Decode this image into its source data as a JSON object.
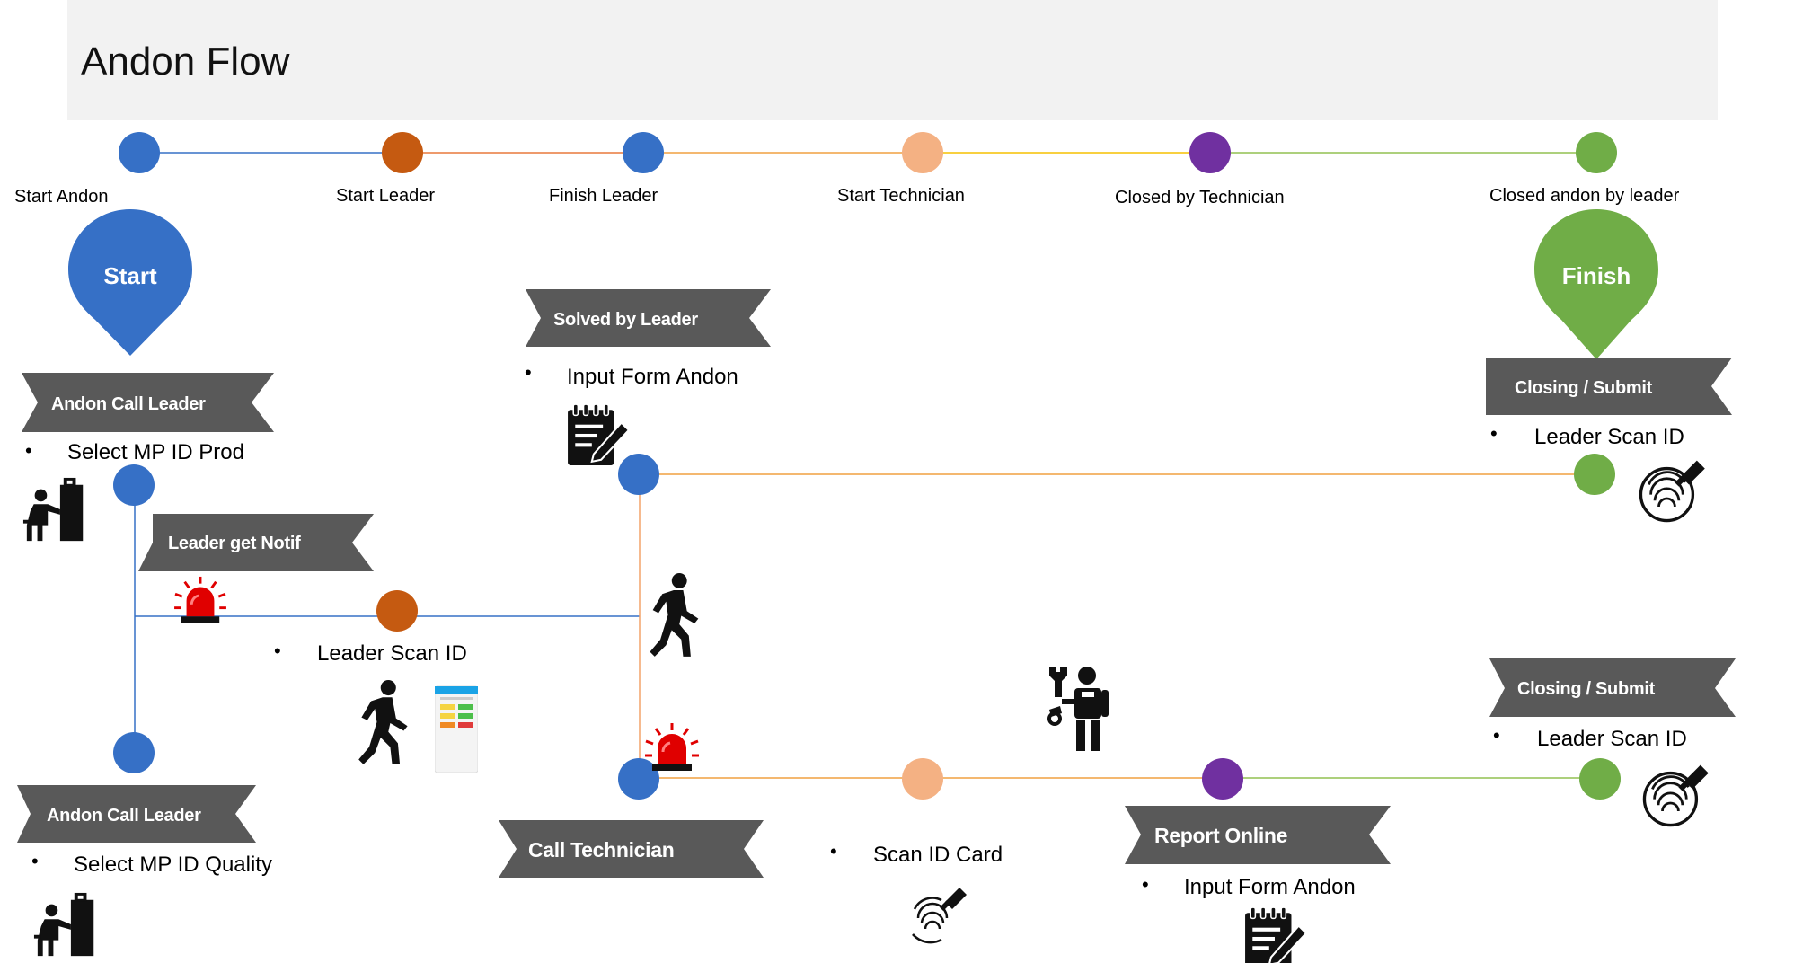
{
  "title": "Andon Flow",
  "colors": {
    "blue": "#3670c6",
    "orange": "#c55a11",
    "peach": "#f4b183",
    "purple": "#7030a0",
    "green": "#70ad47",
    "banner": "#595959",
    "header_bg": "#f2f2f2",
    "alarm": "#e00000"
  },
  "timeline": {
    "stages": [
      {
        "label": "Start Andon",
        "color": "#3670c6"
      },
      {
        "label": "Start Leader",
        "color": "#c55a11"
      },
      {
        "label": "Finish Leader",
        "color": "#3670c6"
      },
      {
        "label": "Start Technician",
        "color": "#f4b183"
      },
      {
        "label": "Closed by Technician",
        "color": "#7030a0"
      },
      {
        "label": "Closed andon by leader",
        "color": "#70ad47"
      }
    ]
  },
  "pins": {
    "start": "Start",
    "finish": "Finish"
  },
  "banners": {
    "andon_call_leader_prod": "Andon Call Leader",
    "leader_get_notif": "Leader get Notif",
    "solved_by_leader": "Solved by Leader",
    "closing_submit_top": "Closing / Submit",
    "closing_submit_bottom": "Closing / Submit",
    "andon_call_leader_quality": "Andon Call Leader",
    "call_technician": "Call Technician",
    "report_online": "Report Online"
  },
  "bullets": {
    "select_mp_prod": "Select MP ID Prod",
    "leader_scan_mid": "Leader Scan ID",
    "input_form_top": "Input Form Andon",
    "leader_scan_top": "Leader Scan ID",
    "select_mp_quality": "Select MP ID Quality",
    "scan_id_card": "Scan ID Card",
    "input_form_bottom": "Input Form Andon",
    "leader_scan_bottom": "Leader Scan ID"
  },
  "icons": {
    "machine": "person-at-machine-icon",
    "alarm": "alarm-light-icon",
    "walk": "walking-person-icon",
    "phone": "phone-app-icon",
    "form": "notepad-pen-icon",
    "fingerprint": "fingerprint-scanner-icon",
    "technician": "technician-robot-icon"
  }
}
